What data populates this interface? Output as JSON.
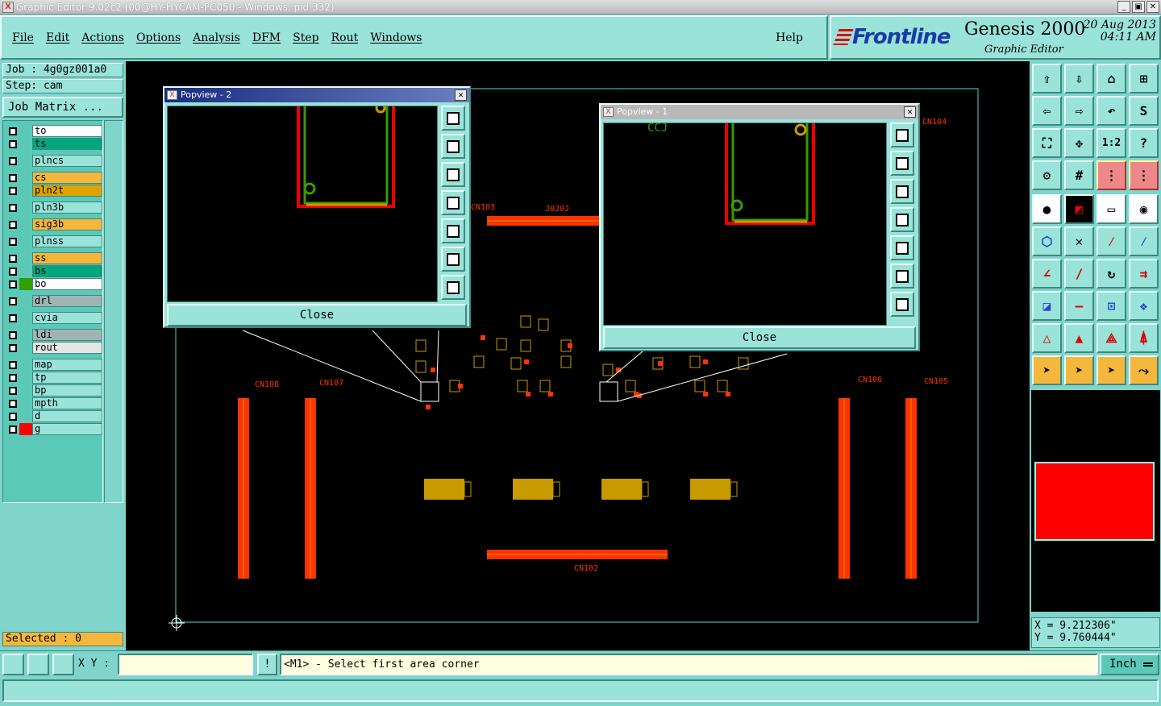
{
  "window": {
    "title": "Graphic Editor 9.02c2 (00@HY-HYCAM-PC050 - Windows, pid:332)",
    "min": "_",
    "max": "▣",
    "close": "✕"
  },
  "menus": [
    "File",
    "Edit",
    "Actions",
    "Options",
    "Analysis",
    "DFM",
    "Step",
    "Rout",
    "Windows"
  ],
  "help": "Help",
  "brand": {
    "logo": "Frontline",
    "product": "Genesis 2000",
    "subtitle": "Graphic Editor",
    "date": "20 Aug 2013",
    "time": "04:11 AM"
  },
  "job": "Job : 4g0gz001a0",
  "step": "Step: cam",
  "job_matrix": "Job Matrix ...",
  "layers": [
    {
      "name": "to",
      "color": "#ffffff",
      "swatch": ""
    },
    {
      "name": "ts",
      "color": "#00a77b",
      "swatch": ""
    },
    {
      "name": "plncs",
      "color": "#9ae3d9",
      "swatch": ""
    },
    {
      "name": "cs",
      "color": "#f5b73b",
      "swatch": ""
    },
    {
      "name": "pln2t",
      "color": "#e0a400",
      "swatch": ""
    },
    {
      "name": "pln3b",
      "color": "#9ae3d9",
      "swatch": ""
    },
    {
      "name": "sig3b",
      "color": "#f5b73b",
      "swatch": ""
    },
    {
      "name": "plnss",
      "color": "#9ae3d9",
      "swatch": ""
    },
    {
      "name": "ss",
      "color": "#f5b73b",
      "swatch": ""
    },
    {
      "name": "bs",
      "color": "#00a77b",
      "swatch": ""
    },
    {
      "name": "bo",
      "color": "#ffffff",
      "swatch": "#2fa000"
    },
    {
      "name": "drl",
      "color": "#a0b4b4",
      "swatch": ""
    },
    {
      "name": "cvia",
      "color": "#9ae3d9",
      "swatch": ""
    },
    {
      "name": "ldi",
      "color": "#a0b4b4",
      "swatch": ""
    },
    {
      "name": "rout",
      "color": "#e6e6e6",
      "swatch": ""
    },
    {
      "name": "map",
      "color": "#9ae3d9",
      "swatch": ""
    },
    {
      "name": "tp",
      "color": "#9ae3d9",
      "swatch": ""
    },
    {
      "name": "bp",
      "color": "#9ae3d9",
      "swatch": ""
    },
    {
      "name": "mpth",
      "color": "#9ae3d9",
      "swatch": ""
    },
    {
      "name": "d",
      "color": "#9ae3d9",
      "swatch": ""
    },
    {
      "name": "g",
      "color": "#9ae3d9",
      "swatch": "#ff0000"
    }
  ],
  "selected": "Selected : 0",
  "popview2": {
    "title": "Popview - 2",
    "close": "Close"
  },
  "popview1": {
    "title": "Popview - 1",
    "close": "Close"
  },
  "board_labels": {
    "top_conn": "CN103",
    "top_conn2": "J0J0J",
    "bottom_conn": "CN102",
    "left1": "CN108",
    "left2": "CN107",
    "right1": "CN106",
    "right2": "CN105",
    "right3": "CN104",
    "pv1_label": "CCJ"
  },
  "coords": {
    "x": "X = 9.212306\"",
    "y": "Y = 9.760444\""
  },
  "status": {
    "xy_label": "X Y :",
    "xy_value": "",
    "bang": "!",
    "prompt": "<M1> - Select first area corner",
    "unit": "Inch"
  },
  "colors": {
    "canvas": "#000000",
    "pad": "#ff3300",
    "component": "#c89a00",
    "outline": "#4fd8c8",
    "accent": "#9ae3d9"
  }
}
